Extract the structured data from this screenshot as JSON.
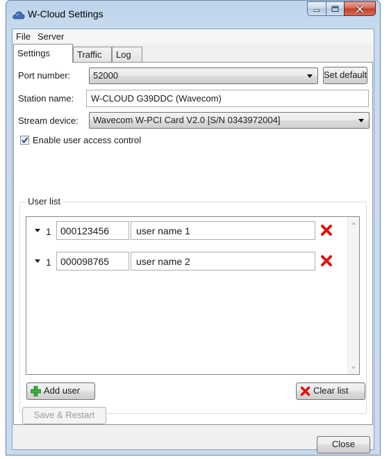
{
  "window": {
    "title": "W-Cloud Settings",
    "colors": {
      "accent_selected": "#3399ff",
      "delete_icon": "#e01010",
      "add_icon": "#3bb33b"
    }
  },
  "menu": [
    "File",
    "Server"
  ],
  "tabs": [
    "Settings",
    "Traffic",
    "Log"
  ],
  "active_tab": "Settings",
  "settings": {
    "port_label": "Port number:",
    "port_value": "52000",
    "set_default_label": "Set default",
    "station_label": "Station name:",
    "station_value": "W-CLOUD G39DDC (Wavecom)",
    "stream_label": "Stream device:",
    "stream_value": "Wavecom W-PCI Card V2.0 [S/N 0343972004]",
    "access_control_label": "Enable user access control",
    "access_control_checked": true
  },
  "user_list": {
    "title": "User list",
    "users": [
      {
        "num": "1",
        "id": "000123456",
        "name": "user name 1"
      },
      {
        "num": "1",
        "id": "000098765",
        "name": "user name 2"
      }
    ],
    "add_label": "Add user",
    "clear_label": "Clear list"
  },
  "save_label": "Save & Restart",
  "close_label": "Close"
}
